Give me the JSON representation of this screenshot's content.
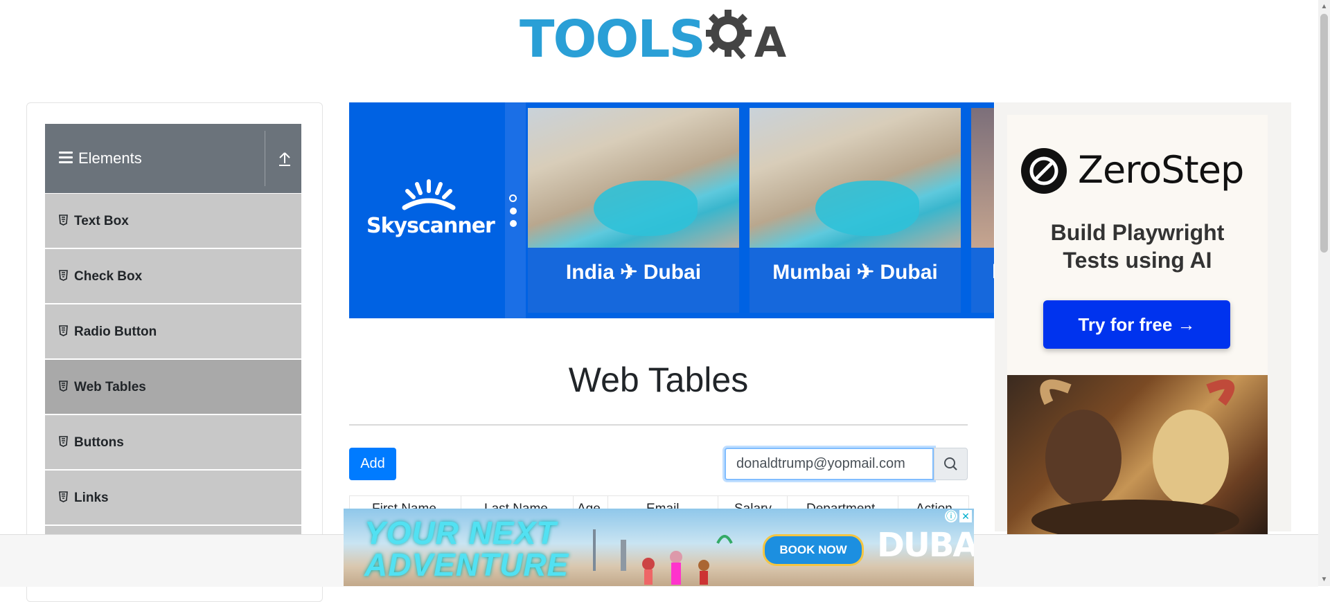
{
  "header": {
    "logo_part1": "TOOLS",
    "logo_part2": "QA",
    "colors": {
      "tools": "#2a9fd6",
      "qa": "#444444"
    }
  },
  "sidebar": {
    "group_title": "Elements",
    "items": [
      {
        "label": "Text Box",
        "active": false
      },
      {
        "label": "Check Box",
        "active": false
      },
      {
        "label": "Radio Button",
        "active": false
      },
      {
        "label": "Web Tables",
        "active": true
      },
      {
        "label": "Buttons",
        "active": false
      },
      {
        "label": "Links",
        "active": false
      }
    ]
  },
  "sky_ad": {
    "brand": "Skyscanner",
    "routes": [
      "India ✈ Dubai",
      "Mumbai ✈ Dubai",
      "I"
    ],
    "color": "#0062e3"
  },
  "side_ad": {
    "brand": "ZeroStep",
    "tagline_line1": "Build Playwright",
    "tagline_line2": "Tests using AI",
    "cta": "Try for free →"
  },
  "main": {
    "title": "Web Tables",
    "add_label": "Add",
    "search_value": "donaldtrump@yopmail.com",
    "columns": [
      "First Name",
      "Last Name",
      "Age",
      "Email",
      "Salary",
      "Department",
      "Action"
    ]
  },
  "bottom_ad": {
    "headline_line1": "YOUR NEXT",
    "headline_line2": "ADVENTURE",
    "cta": "BOOK NOW",
    "brand": "DUBAI"
  }
}
